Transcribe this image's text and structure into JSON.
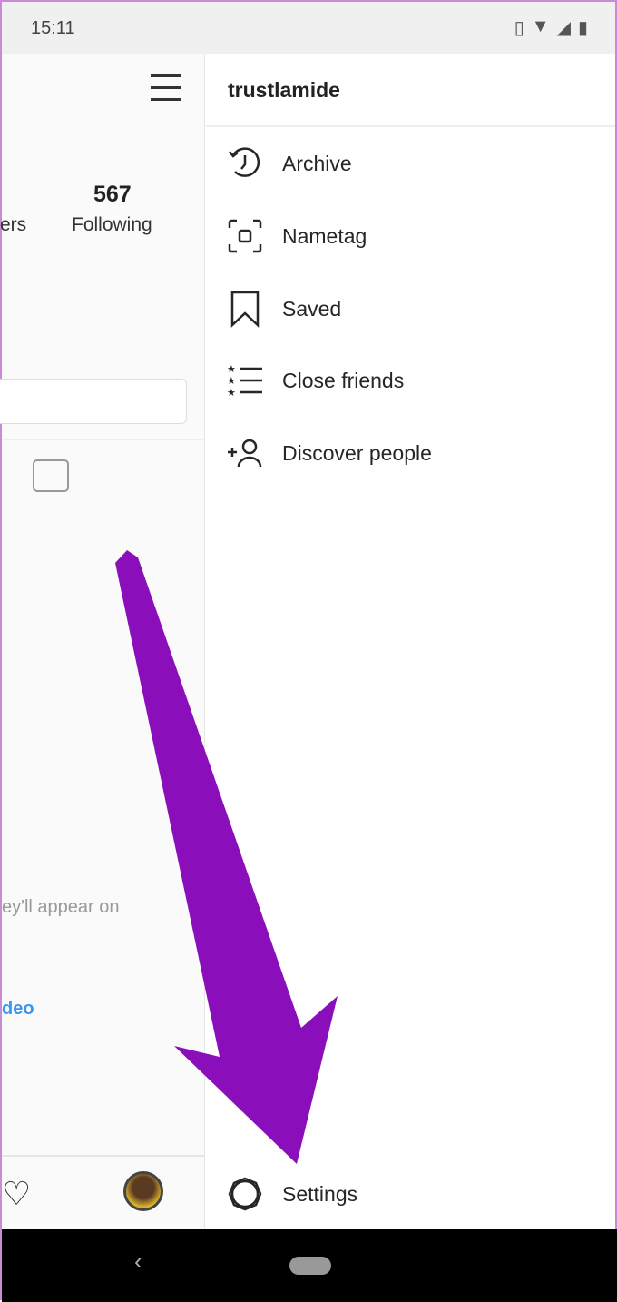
{
  "status_bar": {
    "time": "15:11",
    "icons": [
      "vibrate-icon",
      "wifi-icon",
      "signal-icon",
      "battery-icon"
    ]
  },
  "profile": {
    "following_count": "567",
    "following_label": "Following",
    "followers_label_partial": "ers",
    "empty_text_partial": "ey'll appear on",
    "link_partial": "deo"
  },
  "drawer": {
    "username": "trustlamide",
    "items": [
      {
        "label": "Archive",
        "icon": "archive-icon"
      },
      {
        "label": "Nametag",
        "icon": "nametag-icon"
      },
      {
        "label": "Saved",
        "icon": "bookmark-icon"
      },
      {
        "label": "Close friends",
        "icon": "close-friends-icon"
      },
      {
        "label": "Discover people",
        "icon": "add-person-icon"
      }
    ],
    "settings_label": "Settings"
  },
  "annotation": {
    "arrow_color": "#8a0fba"
  }
}
